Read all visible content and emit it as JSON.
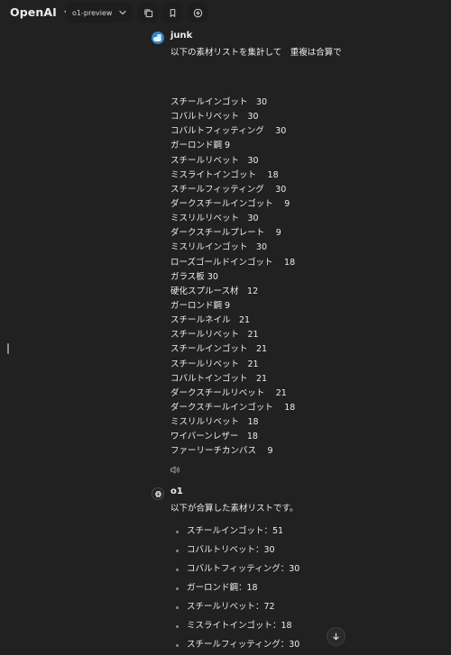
{
  "header": {
    "brand": "OpenAI",
    "model": "o1-preview",
    "icons": [
      "chevron-down-icon",
      "copy-icon",
      "bookmark-icon",
      "plus-circle-icon"
    ]
  },
  "user_message": {
    "author": "junk",
    "intro": "以下の素材リストを集計して　重複は合算で",
    "items": [
      "スチールインゴット　30",
      "コバルトリベット　30",
      "コバルトフィッティング　 30",
      "ガーロンド鋼 9",
      "スチールリベット　30",
      "ミスライトインゴット　 18",
      "スチールフィッティング　 30",
      "ダークスチールインゴット　 9",
      "ミスリルリベット　30",
      "ダークスチールプレート　 9",
      "ミスリルインゴット　30",
      "ローズゴールドインゴット　 18",
      "ガラス板 30",
      "硬化スプルース材　12",
      "ガーロンド鋼 9",
      "スチールネイル　21",
      "スチールリベット　21",
      "スチールインゴット　21",
      "スチールリベット　21",
      "コバルトインゴット　21",
      "ダークスチールリベット　 21",
      "ダークスチールインゴット　 18",
      "ミスリルリベット　18",
      "ワイバーンレザー　18",
      "ファーリーチカンバス　 9"
    ]
  },
  "assistant_message": {
    "author": "o1",
    "intro": "以下が合算した素材リストです。",
    "items": [
      "スチールインゴット：51",
      "コバルトリベット：30",
      "コバルトフィッティング：30",
      "ガーロンド鋼：18",
      "スチールリベット：72",
      "ミスライトインゴット：18",
      "スチールフィッティング：30"
    ]
  },
  "colors": {
    "background": "#212121",
    "text": "#ececec",
    "button_bg": "#1d1d1d",
    "user_avatar": "#2f86c9"
  }
}
